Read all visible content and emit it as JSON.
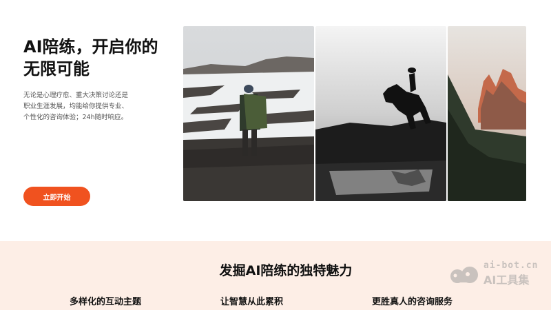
{
  "hero": {
    "title_line1": "AI陪练，开启你的",
    "title_line2": "无限可能",
    "desc_line1": "无论是心理疗愈、重大决策讨论还是",
    "desc_line2": "职业生涯发展，均能给你提供专业、",
    "desc_line3": "个性化的咨询体验；24h随时响应。",
    "cta_label": "立即开始"
  },
  "features": {
    "title": "发掘AI陪练的独特魅力",
    "tabs": [
      {
        "label": "多样化的互动主题"
      },
      {
        "label": "让智慧从此累积"
      },
      {
        "label": "更胜真人的咨询服务"
      }
    ]
  },
  "watermark": {
    "domain": "ai-bot.cn",
    "name": "AI工具集"
  },
  "colors": {
    "accent": "#f0521f",
    "features_bg": "#fdeee6",
    "watermark": "#c9c2be"
  }
}
